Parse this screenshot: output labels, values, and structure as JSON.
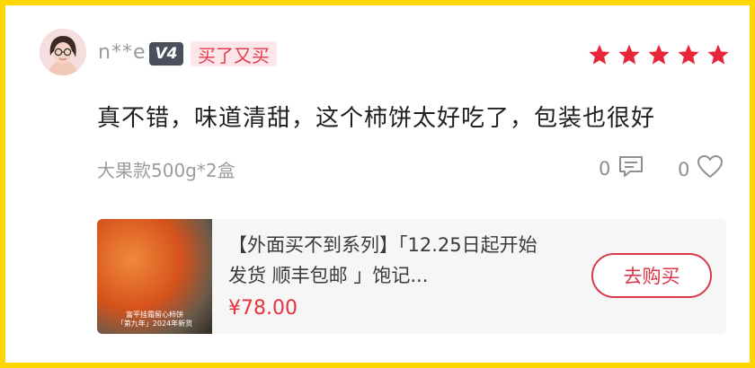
{
  "review": {
    "username": "n**e",
    "vip_level": "V4",
    "tag": "买了又买",
    "rating_stars": 5,
    "text": "真不错，味道清甜，这个柿饼太好吃了，包装也很好",
    "spec": "大果款500g*2盒",
    "comment_count": "0",
    "like_count": "0"
  },
  "product": {
    "title": "【外面买不到系列】「12.25日起开始发货 顺丰包邮 」饱记...",
    "price": "¥78.00",
    "thumb_caption_line1": "富平挂霜留心柿饼",
    "thumb_caption_line2": "「第九年」2024年新货",
    "buy_label": "去购买"
  },
  "colors": {
    "frame": "#ffd600",
    "star": "#e8263a",
    "accent": "#d9374a",
    "price": "#e8323f",
    "vip_badge": "#4b4f5c",
    "tag_bg": "#fde6ea"
  },
  "icons": [
    "avatar",
    "star-icon",
    "comment-icon",
    "heart-icon"
  ]
}
